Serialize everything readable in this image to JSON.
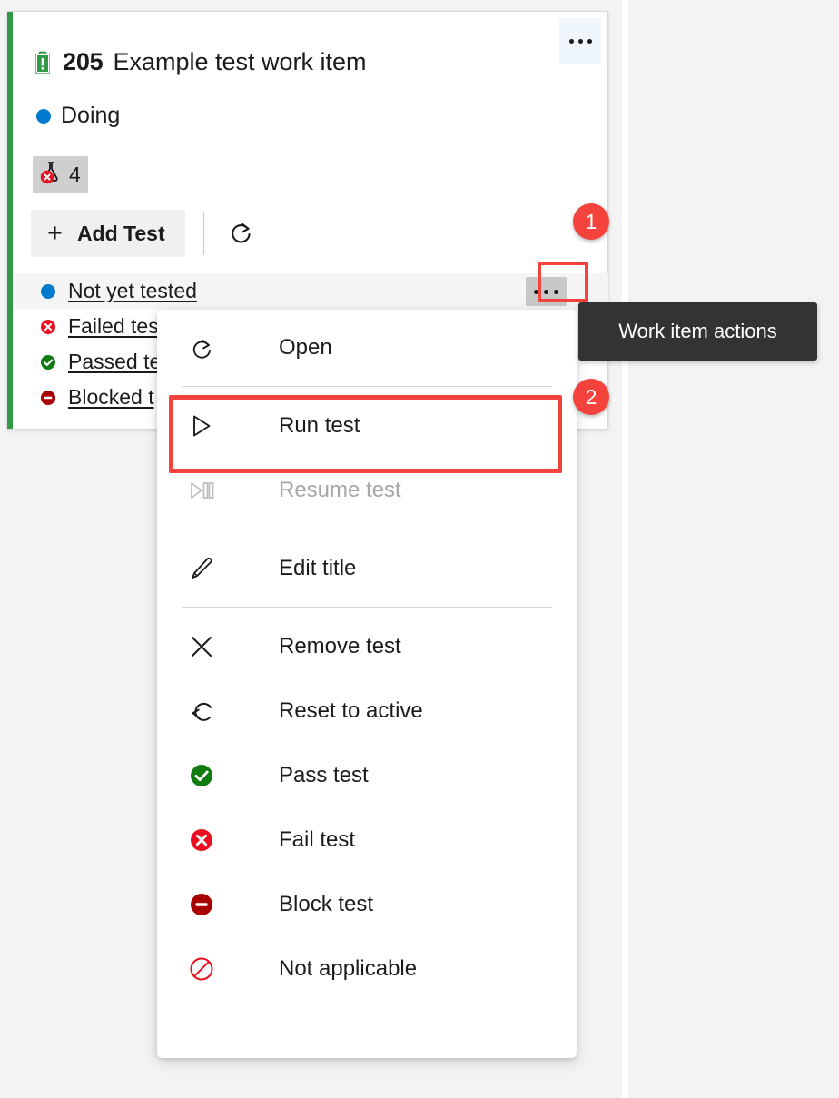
{
  "work_item": {
    "icon": "task-clipboard-icon",
    "id": "205",
    "title": "Example test work item",
    "state": "Doing",
    "state_color": "#007acc",
    "accent_color": "#339947",
    "ellipsis_label": "...",
    "test_badge": {
      "icon": "failed-flask-icon",
      "count": "4"
    }
  },
  "toolbar": {
    "add_test_label": "Add Test",
    "add_test_plus": "+",
    "refresh_icon": "refresh-arrow-icon"
  },
  "test_list": [
    {
      "label": "Not yet tested",
      "status": "active",
      "status_color": "#007acc",
      "hovered": true
    },
    {
      "label": "Failed tes",
      "status": "failed",
      "status_color": "#e81123",
      "hovered": false
    },
    {
      "label": "Passed te",
      "status": "passed",
      "status_color": "#107c10",
      "hovered": false
    },
    {
      "label": "Blocked t",
      "status": "blocked",
      "status_color": "#a80000",
      "hovered": false
    }
  ],
  "context_menu": [
    {
      "label": "Open",
      "icon": "open-external-icon",
      "disabled": false,
      "sep_after": true
    },
    {
      "label": "Run test",
      "icon": "play-icon",
      "disabled": false,
      "highlighted": true,
      "sep_after": false
    },
    {
      "label": "Resume test",
      "icon": "resume-icon",
      "disabled": true,
      "sep_after": true
    },
    {
      "label": "Edit title",
      "icon": "pencil-icon",
      "disabled": false,
      "sep_after": true
    },
    {
      "label": "Remove test",
      "icon": "close-x-icon",
      "disabled": false,
      "sep_after": false
    },
    {
      "label": "Reset to active",
      "icon": "undo-arrow-icon",
      "disabled": false,
      "sep_after": false
    },
    {
      "label": "Pass test",
      "icon": "pass-check-icon",
      "disabled": false,
      "sep_after": false
    },
    {
      "label": "Fail test",
      "icon": "fail-x-icon",
      "disabled": false,
      "sep_after": false
    },
    {
      "label": "Block test",
      "icon": "block-minus-icon",
      "disabled": false,
      "sep_after": false
    },
    {
      "label": "Not applicable",
      "icon": "not-applicable-icon",
      "disabled": false,
      "sep_after": false
    }
  ],
  "tooltip": {
    "text": "Work item actions"
  },
  "callouts": [
    {
      "number": "1"
    },
    {
      "number": "2"
    }
  ],
  "colors": {
    "highlight": "#f4433c",
    "tooltip_bg": "#333333",
    "hover_blue": "#eff6fc"
  }
}
